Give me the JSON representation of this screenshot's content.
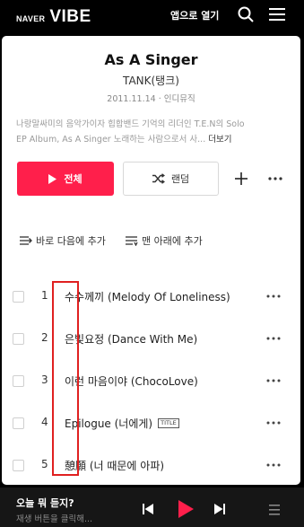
{
  "header": {
    "logo_naver": "NAVER",
    "logo_vibe": "VIBE",
    "open_app": "앱으로 열기"
  },
  "album": {
    "title": "As A Singer",
    "artist": "TANK(탱크)",
    "meta": "2011.11.14 · 인디뮤직",
    "description_line1": "나랑말싸미의 음악가이자 힙합밴드 기억의 리더인 T.E.N의 Solo",
    "description_line2": "EP Album, As A Singer 노래하는 사람으로서 사...",
    "description_more": "더보기"
  },
  "actions": {
    "play_all": "전체",
    "shuffle": "랜덤",
    "play_next": "바로 다음에 추가",
    "play_last": "맨 아래에 추가"
  },
  "tracks": [
    {
      "num": "1",
      "title": "수수께끼 (Melody Of Loneliness)",
      "badge": ""
    },
    {
      "num": "2",
      "title": "은빛요정 (Dance With Me)",
      "badge": ""
    },
    {
      "num": "3",
      "title": "이런 마음이야 (ChocoLove)",
      "badge": ""
    },
    {
      "num": "4",
      "title": "Epilogue (너에게)",
      "badge": "TITLE"
    },
    {
      "num": "5",
      "title": "憩願 (너 때문에 아파)",
      "badge": ""
    }
  ],
  "player": {
    "title": "오늘 뭐 듣지?",
    "subtitle": "재생 버튼을 클릭해..."
  },
  "colors": {
    "accent": "#ff1f4b",
    "annotation": "#e02020",
    "background": "#000000",
    "player_bg": "#161616"
  },
  "icons": [
    "search-icon",
    "menu-icon",
    "play-icon",
    "shuffle-icon",
    "plus-icon",
    "more-icon",
    "queue-next-icon",
    "queue-last-icon",
    "prev-icon",
    "next-icon",
    "playlist-icon"
  ]
}
